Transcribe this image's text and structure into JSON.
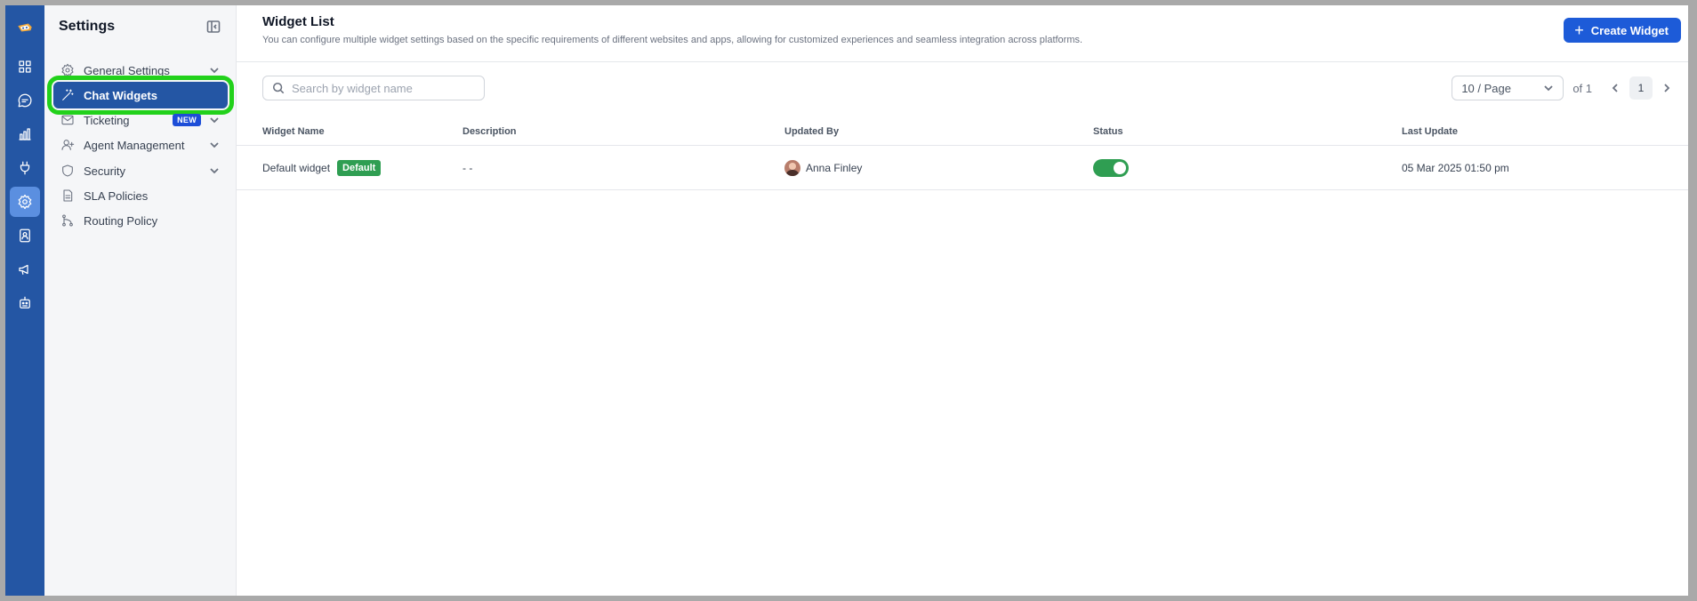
{
  "rail": {
    "items": [
      {
        "icon": "dashboard-grid-icon"
      },
      {
        "icon": "chat-bubble-icon"
      },
      {
        "icon": "bar-chart-icon"
      },
      {
        "icon": "plug-icon"
      },
      {
        "icon": "gear-icon",
        "active": true
      },
      {
        "icon": "contact-book-icon"
      },
      {
        "icon": "megaphone-icon"
      },
      {
        "icon": "bot-icon"
      }
    ]
  },
  "sidebar": {
    "title": "Settings",
    "items": [
      {
        "label": "General Settings",
        "icon": "gear-icon",
        "expandable": true
      },
      {
        "label": "Chat Widgets",
        "icon": "magic-wand-icon",
        "active": true
      },
      {
        "label": "Ticketing",
        "icon": "mail-icon",
        "badge": "NEW",
        "expandable": true
      },
      {
        "label": "Agent Management",
        "icon": "user-plus-icon",
        "expandable": true
      },
      {
        "label": "Security",
        "icon": "shield-icon",
        "expandable": true
      },
      {
        "label": "SLA Policies",
        "icon": "document-icon"
      },
      {
        "label": "Routing Policy",
        "icon": "route-icon"
      }
    ]
  },
  "main": {
    "title": "Widget List",
    "subtitle": "You can configure multiple widget settings based on the specific requirements of different websites and apps, allowing for customized experiences and seamless integration across platforms.",
    "create_button": "Create Widget",
    "search_placeholder": "Search by widget name",
    "pager": {
      "page_size": "10 / Page",
      "of_text": "of 1",
      "current_page": "1"
    },
    "table": {
      "columns": [
        "Widget Name",
        "Description",
        "Updated By",
        "Status",
        "Last Update"
      ],
      "rows": [
        {
          "name": "Default widget",
          "badge": "Default",
          "description": "- -",
          "updated_by": "Anna Finley",
          "status_on": true,
          "last_update": "05 Mar 2025 01:50 pm"
        }
      ]
    }
  },
  "colors": {
    "rail_bg": "#2456a4",
    "primary": "#1d5bd8",
    "active_highlight": "#22d11b",
    "success": "#2f9e52"
  }
}
